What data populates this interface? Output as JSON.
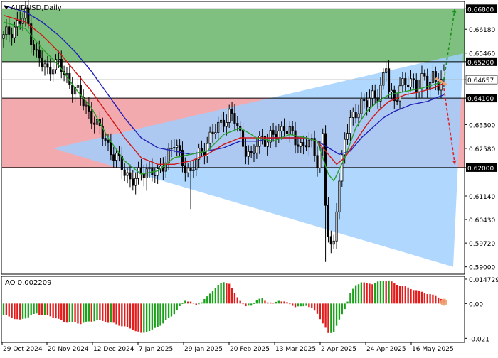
{
  "window": {
    "title": "AUDUSD,Daily",
    "menu_icon": "dropdown-triangle-icon"
  },
  "indicator": {
    "label": "AO 0.002209"
  },
  "colors": {
    "bg": "#ffffff",
    "green_zone": "#7fbf7f",
    "red_zone": "#f3aaaf",
    "blue_triangle": "#9fd0ff",
    "ma_fast": "#2aa02a",
    "ma_mid": "#d01818",
    "ma_slow": "#2020b8",
    "candles": "#000000",
    "ao_up": "#1aa31a",
    "ao_down": "#e21b1b",
    "arrow_up": "#1a8f1a",
    "arrow_down": "#e02020",
    "arrow_flat": "#f0a070"
  },
  "chart_data": [
    {
      "type": "candlestick",
      "symbol": "AUDUSD",
      "timeframe": "Daily",
      "title": "AUDUSD,Daily",
      "x_ticks": [
        "29 Oct 2024",
        "20 Nov 2024",
        "12 Dec 2024",
        "7 Jan 2025",
        "29 Jan 2025",
        "20 Feb 2025",
        "13 Mar 2025",
        "2 Apr 2025",
        "24 Apr 2025",
        "16 May 2025"
      ],
      "y_ticks": [
        0.59,
        0.5972,
        0.6043,
        0.6114,
        0.62,
        0.6258,
        0.633,
        0.641,
        0.64657,
        0.652,
        0.6546,
        0.6618,
        0.668
      ],
      "y_tick_labels": [
        "0.59000",
        "0.59720",
        "0.60430",
        "0.61140",
        "0.62000",
        "0.62580",
        "0.63300",
        "0.64100",
        "0.64657",
        "0.65200",
        "0.65460",
        "0.66180",
        "0.66800"
      ],
      "highlighted_levels": [
        0.668,
        0.652,
        0.641,
        0.62
      ],
      "current_price": 0.64657,
      "ylim": [
        0.588,
        0.67
      ],
      "zones": [
        {
          "name": "buy-zone",
          "from": 0.652,
          "to": 0.668
        },
        {
          "name": "sell-zone",
          "from": 0.62,
          "to": 0.641
        }
      ],
      "triangle_pattern": true,
      "price_path": [
        [
          0,
          0.659
        ],
        [
          3,
          0.662
        ],
        [
          6,
          0.664
        ],
        [
          8,
          0.666
        ],
        [
          10,
          0.66
        ],
        [
          12,
          0.654
        ],
        [
          14,
          0.651
        ],
        [
          16,
          0.649
        ],
        [
          18,
          0.652
        ],
        [
          20,
          0.651
        ],
        [
          22,
          0.648
        ],
        [
          24,
          0.646
        ],
        [
          26,
          0.644
        ],
        [
          28,
          0.641
        ],
        [
          30,
          0.638
        ],
        [
          32,
          0.636
        ],
        [
          34,
          0.632
        ],
        [
          36,
          0.63
        ],
        [
          38,
          0.627
        ],
        [
          40,
          0.624
        ],
        [
          42,
          0.621
        ],
        [
          44,
          0.619
        ],
        [
          46,
          0.617
        ],
        [
          48,
          0.616
        ],
        [
          50,
          0.618
        ],
        [
          52,
          0.62
        ],
        [
          54,
          0.619
        ],
        [
          56,
          0.617
        ],
        [
          58,
          0.621
        ],
        [
          60,
          0.625
        ],
        [
          62,
          0.627
        ],
        [
          64,
          0.623
        ],
        [
          66,
          0.621
        ],
        [
          68,
          0.618
        ],
        [
          70,
          0.622
        ],
        [
          72,
          0.625
        ],
        [
          74,
          0.628
        ],
        [
          76,
          0.63
        ],
        [
          78,
          0.632
        ],
        [
          80,
          0.635
        ],
        [
          82,
          0.636
        ],
        [
          84,
          0.634
        ],
        [
          86,
          0.63
        ],
        [
          88,
          0.626
        ],
        [
          90,
          0.622
        ],
        [
          92,
          0.627
        ],
        [
          94,
          0.63
        ],
        [
          96,
          0.628
        ],
        [
          98,
          0.629
        ],
        [
          100,
          0.631
        ],
        [
          102,
          0.633
        ],
        [
          104,
          0.63
        ],
        [
          106,
          0.628
        ],
        [
          108,
          0.627
        ],
        [
          110,
          0.628
        ],
        [
          112,
          0.626
        ],
        [
          114,
          0.622
        ],
        [
          116,
          0.63
        ],
        [
          117,
          0.61
        ],
        [
          118,
          0.599
        ],
        [
          119,
          0.594
        ],
        [
          120,
          0.597
        ],
        [
          121,
          0.609
        ],
        [
          122,
          0.617
        ],
        [
          123,
          0.623
        ],
        [
          124,
          0.629
        ],
        [
          126,
          0.633
        ],
        [
          128,
          0.637
        ],
        [
          130,
          0.64
        ],
        [
          132,
          0.639
        ],
        [
          134,
          0.641
        ],
        [
          136,
          0.643
        ],
        [
          138,
          0.647
        ],
        [
          139,
          0.65
        ],
        [
          140,
          0.643
        ],
        [
          142,
          0.64
        ],
        [
          144,
          0.646
        ],
        [
          146,
          0.644
        ],
        [
          148,
          0.646
        ],
        [
          150,
          0.645
        ],
        [
          152,
          0.647
        ],
        [
          154,
          0.644
        ],
        [
          156,
          0.648
        ],
        [
          158,
          0.646
        ],
        [
          160,
          0.6466
        ]
      ],
      "price_spikes": [
        {
          "i": 117,
          "low": 0.5915
        },
        {
          "i": 68,
          "low": 0.6075
        },
        {
          "i": 52,
          "low": 0.613
        }
      ],
      "ma_fast": [
        [
          0,
          0.664
        ],
        [
          8,
          0.662
        ],
        [
          14,
          0.656
        ],
        [
          20,
          0.651
        ],
        [
          26,
          0.644
        ],
        [
          32,
          0.638
        ],
        [
          38,
          0.629
        ],
        [
          44,
          0.622
        ],
        [
          50,
          0.618
        ],
        [
          56,
          0.619
        ],
        [
          62,
          0.623
        ],
        [
          68,
          0.624
        ],
        [
          74,
          0.625
        ],
        [
          80,
          0.63
        ],
        [
          86,
          0.632
        ],
        [
          92,
          0.629
        ],
        [
          98,
          0.628
        ],
        [
          104,
          0.63
        ],
        [
          110,
          0.629
        ],
        [
          114,
          0.628
        ],
        [
          118,
          0.618
        ],
        [
          120,
          0.616
        ],
        [
          124,
          0.623
        ],
        [
          128,
          0.632
        ],
        [
          132,
          0.637
        ],
        [
          136,
          0.64
        ],
        [
          140,
          0.642
        ],
        [
          146,
          0.643
        ],
        [
          152,
          0.644
        ],
        [
          156,
          0.645
        ],
        [
          160,
          0.646
        ]
      ],
      "ma_mid": [
        [
          0,
          0.666
        ],
        [
          8,
          0.664
        ],
        [
          14,
          0.66
        ],
        [
          20,
          0.655
        ],
        [
          26,
          0.649
        ],
        [
          32,
          0.643
        ],
        [
          38,
          0.636
        ],
        [
          44,
          0.629
        ],
        [
          50,
          0.623
        ],
        [
          56,
          0.621
        ],
        [
          62,
          0.621
        ],
        [
          68,
          0.622
        ],
        [
          74,
          0.624
        ],
        [
          80,
          0.627
        ],
        [
          86,
          0.629
        ],
        [
          92,
          0.629
        ],
        [
          98,
          0.629
        ],
        [
          104,
          0.629
        ],
        [
          110,
          0.629
        ],
        [
          114,
          0.628
        ],
        [
          118,
          0.624
        ],
        [
          121,
          0.621
        ],
        [
          124,
          0.623
        ],
        [
          128,
          0.628
        ],
        [
          132,
          0.633
        ],
        [
          136,
          0.637
        ],
        [
          140,
          0.64
        ],
        [
          146,
          0.642
        ],
        [
          152,
          0.643
        ],
        [
          156,
          0.644
        ],
        [
          160,
          0.6455
        ]
      ],
      "ma_slow": [
        [
          0,
          0.669
        ],
        [
          8,
          0.667
        ],
        [
          14,
          0.664
        ],
        [
          20,
          0.66
        ],
        [
          26,
          0.655
        ],
        [
          32,
          0.649
        ],
        [
          38,
          0.642
        ],
        [
          44,
          0.635
        ],
        [
          50,
          0.629
        ],
        [
          56,
          0.626
        ],
        [
          62,
          0.625
        ],
        [
          68,
          0.624
        ],
        [
          74,
          0.625
        ],
        [
          80,
          0.626
        ],
        [
          86,
          0.628
        ],
        [
          92,
          0.628
        ],
        [
          98,
          0.629
        ],
        [
          104,
          0.629
        ],
        [
          110,
          0.629
        ],
        [
          114,
          0.628
        ],
        [
          118,
          0.626
        ],
        [
          122,
          0.624
        ],
        [
          126,
          0.625
        ],
        [
          130,
          0.629
        ],
        [
          134,
          0.632
        ],
        [
          138,
          0.635
        ],
        [
          142,
          0.637
        ],
        [
          148,
          0.639
        ],
        [
          154,
          0.64
        ],
        [
          160,
          0.642
        ]
      ],
      "forecast_arrows": [
        {
          "name": "bullish-forecast",
          "from": [
            160,
            0.6466
          ],
          "to": [
            164,
            0.668
          ]
        },
        {
          "name": "bearish-forecast",
          "from": [
            160,
            0.644
          ],
          "to": [
            164,
            0.621
          ]
        },
        {
          "name": "flat-forecast",
          "from": [
            157,
            0.647
          ],
          "to": [
            161,
            0.645
          ]
        }
      ],
      "n_bars": 161
    },
    {
      "type": "bar",
      "name": "Awesome Oscillator",
      "title": "AO 0.002209",
      "current_value": 0.002209,
      "y_tick_labels": [
        "0.014729",
        "0.00",
        "-0.021"
      ],
      "ylim": [
        -0.023,
        0.016
      ],
      "ao_path": [
        [
          0,
          -0.007
        ],
        [
          6,
          -0.01
        ],
        [
          12,
          -0.006
        ],
        [
          18,
          -0.008
        ],
        [
          22,
          -0.011
        ],
        [
          28,
          -0.012
        ],
        [
          34,
          -0.01
        ],
        [
          40,
          -0.012
        ],
        [
          46,
          -0.015
        ],
        [
          50,
          -0.018
        ],
        [
          54,
          -0.016
        ],
        [
          58,
          -0.012
        ],
        [
          62,
          -0.006
        ],
        [
          64,
          -0.002
        ],
        [
          66,
          0.002
        ],
        [
          68,
          0.001
        ],
        [
          70,
          -0.001
        ],
        [
          72,
          0.001
        ],
        [
          74,
          0.004
        ],
        [
          76,
          0.008
        ],
        [
          78,
          0.011
        ],
        [
          80,
          0.013
        ],
        [
          82,
          0.012
        ],
        [
          84,
          0.006
        ],
        [
          86,
          0.002
        ],
        [
          88,
          -0.002
        ],
        [
          90,
          -0.001
        ],
        [
          92,
          0.002
        ],
        [
          94,
          0.003
        ],
        [
          96,
          0.001
        ],
        [
          98,
          0.0
        ],
        [
          100,
          0.002
        ],
        [
          102,
          0.001
        ],
        [
          104,
          0.0
        ],
        [
          106,
          -0.002
        ],
        [
          108,
          -0.002
        ],
        [
          110,
          -0.001
        ],
        [
          112,
          -0.003
        ],
        [
          114,
          -0.006
        ],
        [
          116,
          -0.012
        ],
        [
          118,
          -0.018
        ],
        [
          120,
          -0.017
        ],
        [
          122,
          -0.01
        ],
        [
          124,
          -0.003
        ],
        [
          126,
          0.006
        ],
        [
          128,
          0.011
        ],
        [
          130,
          0.013
        ],
        [
          132,
          0.012
        ],
        [
          134,
          0.012
        ],
        [
          136,
          0.013
        ],
        [
          138,
          0.014
        ],
        [
          140,
          0.014
        ],
        [
          142,
          0.012
        ],
        [
          144,
          0.011
        ],
        [
          146,
          0.01
        ],
        [
          148,
          0.009
        ],
        [
          150,
          0.008
        ],
        [
          152,
          0.007
        ],
        [
          154,
          0.006
        ],
        [
          156,
          0.005
        ],
        [
          158,
          0.004
        ],
        [
          160,
          0.002
        ]
      ]
    }
  ]
}
